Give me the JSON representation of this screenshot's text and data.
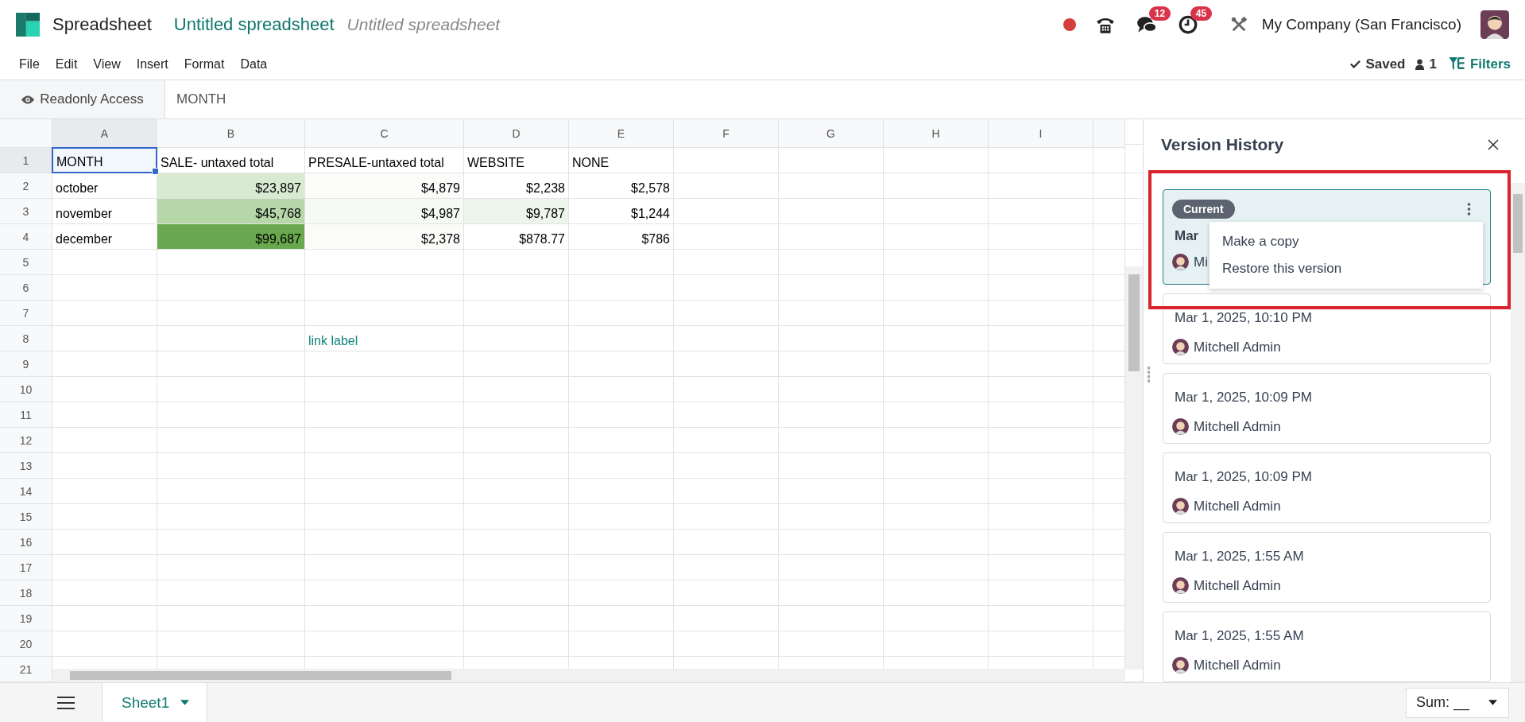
{
  "app": {
    "name": "Spreadsheet",
    "document_title": "Untitled spreadsheet",
    "title_field_value": "Untitled spreadsheet"
  },
  "systray": {
    "recording": true,
    "messages_badge": "12",
    "activities_badge": "45",
    "company": "My Company (San Francisco)"
  },
  "menu": [
    "File",
    "Edit",
    "View",
    "Insert",
    "Format",
    "Data"
  ],
  "status": {
    "saved": "Saved",
    "users": "1",
    "filters": "Filters"
  },
  "formula_bar": {
    "access": "Readonly Access",
    "value": "MONTH"
  },
  "columns": [
    {
      "label": "A",
      "selected": true
    },
    {
      "label": "B",
      "selected": false
    },
    {
      "label": "C",
      "selected": false
    },
    {
      "label": "D",
      "selected": false
    },
    {
      "label": "E",
      "selected": false
    },
    {
      "label": "F",
      "selected": false
    },
    {
      "label": "G",
      "selected": false
    },
    {
      "label": "H",
      "selected": false
    },
    {
      "label": "I",
      "selected": false
    }
  ],
  "rows": [
    {
      "number": "1",
      "selected": true,
      "cells": [
        {
          "kind": "text",
          "text": "MONTH",
          "selected": true
        },
        {
          "kind": "text",
          "text": "SALE- untaxed total",
          "selected": false
        },
        {
          "kind": "text",
          "text": "PRESALE-untaxed total",
          "selected": false
        },
        {
          "kind": "text",
          "text": "WEBSITE",
          "selected": false
        },
        {
          "kind": "text",
          "text": "NONE",
          "selected": false
        }
      ]
    },
    {
      "number": "2",
      "selected": false,
      "cells": [
        {
          "kind": "text",
          "text": "october",
          "selected": false
        },
        {
          "kind": "number",
          "text": "$23,897",
          "selected": false,
          "color": "#d9ead3"
        },
        {
          "kind": "number",
          "text": "$4,879",
          "selected": false,
          "color": "#fbfcfa"
        },
        {
          "kind": "number",
          "text": "$2,238",
          "selected": false
        },
        {
          "kind": "number",
          "text": "$2,578",
          "selected": false
        }
      ]
    },
    {
      "number": "3",
      "selected": false,
      "cells": [
        {
          "kind": "text",
          "text": "november",
          "selected": false
        },
        {
          "kind": "number",
          "text": "$45,768",
          "selected": false,
          "color": "#b6d7a8"
        },
        {
          "kind": "number",
          "text": "$4,987",
          "selected": false,
          "color": "#f6faf4"
        },
        {
          "kind": "number",
          "text": "$9,787",
          "selected": false,
          "color": "#eef5ea"
        },
        {
          "kind": "number",
          "text": "$1,244",
          "selected": false
        }
      ]
    },
    {
      "number": "4",
      "selected": false,
      "cells": [
        {
          "kind": "text",
          "text": "december",
          "selected": false
        },
        {
          "kind": "number",
          "text": "$99,687",
          "selected": false,
          "color": "#6aa84f"
        },
        {
          "kind": "number",
          "text": "$2,378",
          "selected": false,
          "color": "#fbfcfa"
        },
        {
          "kind": "number",
          "text": "$878.77",
          "selected": false
        },
        {
          "kind": "number",
          "text": "$786",
          "selected": false
        }
      ]
    },
    {
      "number": "5",
      "selected": false
    },
    {
      "number": "6",
      "selected": false
    },
    {
      "number": "7",
      "selected": false
    },
    {
      "number": "8",
      "selected": false,
      "cells": [
        {
          "kind": "empty"
        },
        {
          "kind": "empty"
        },
        {
          "kind": "link",
          "text": "link label",
          "selected": false
        }
      ]
    },
    {
      "number": "9",
      "selected": false
    },
    {
      "number": "10",
      "selected": false
    },
    {
      "number": "11",
      "selected": false
    },
    {
      "number": "12",
      "selected": false
    },
    {
      "number": "13",
      "selected": false
    },
    {
      "number": "14",
      "selected": false
    },
    {
      "number": "15",
      "selected": false
    },
    {
      "number": "16",
      "selected": false
    },
    {
      "number": "17",
      "selected": false
    },
    {
      "number": "18",
      "selected": false
    },
    {
      "number": "19",
      "selected": false
    },
    {
      "number": "20",
      "selected": false
    },
    {
      "number": "21",
      "selected": false
    }
  ],
  "version_history": {
    "title": "Version History",
    "versions": [
      {
        "current_badge": "Current",
        "date": "Mar",
        "user": "Mi",
        "selected": true
      },
      {
        "date": "Mar 1, 2025, 10:10 PM",
        "user": "Mitchell Admin",
        "selected": false
      },
      {
        "date": "Mar 1, 2025, 10:09 PM",
        "user": "Mitchell Admin",
        "selected": false
      },
      {
        "date": "Mar 1, 2025, 10:09 PM",
        "user": "Mitchell Admin",
        "selected": false
      },
      {
        "date": "Mar 1, 2025, 1:55 AM",
        "user": "Mitchell Admin",
        "selected": false
      },
      {
        "date": "Mar 1, 2025, 1:55 AM",
        "user": "Mitchell Admin",
        "selected": false
      }
    ],
    "menu": [
      "Make a copy",
      "Restore this version"
    ]
  },
  "bottom_bar": {
    "sheets": [
      {
        "name": "Sheet1",
        "selected": true
      }
    ],
    "aggregate": "Sum: __"
  }
}
